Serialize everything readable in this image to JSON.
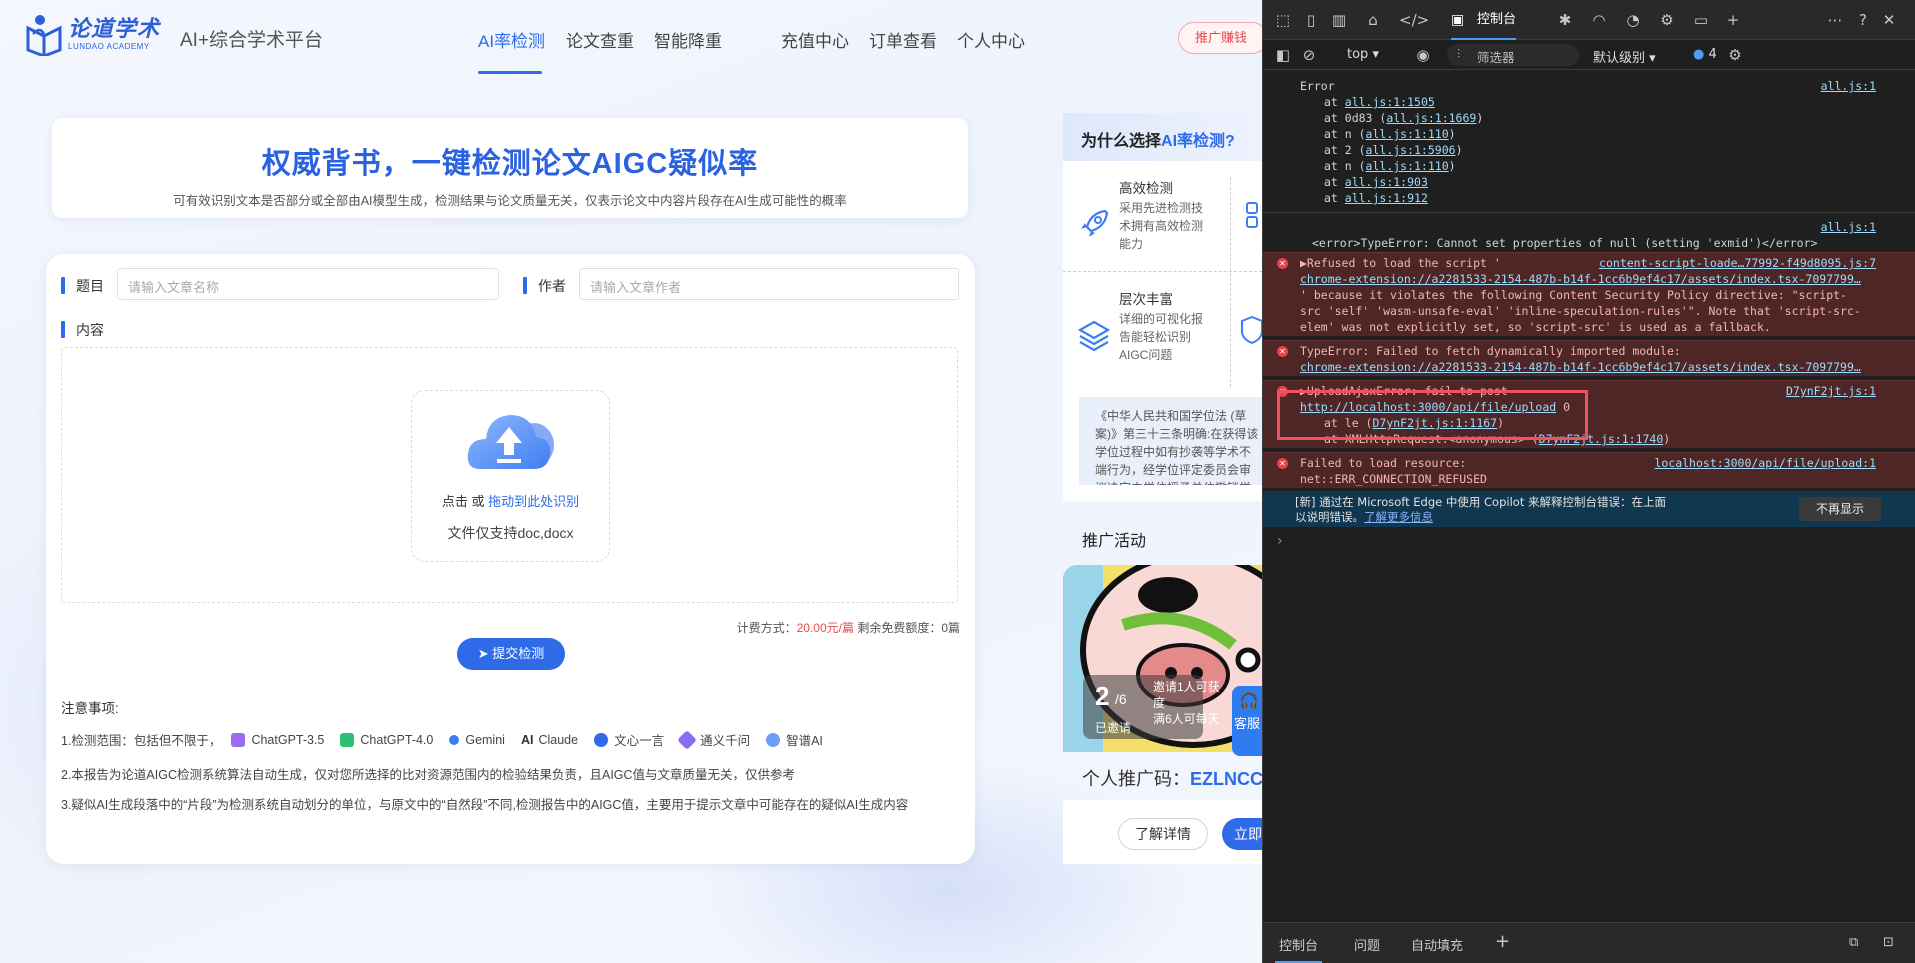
{
  "header": {
    "logo_cn": "论道学术",
    "logo_en": "LUNDAO ACADEMY",
    "platform": "AI+综合学术平台",
    "nav": [
      "AI率检测",
      "论文查重",
      "智能降重",
      "充值中心",
      "订单查看",
      "个人中心"
    ],
    "promo_button": "推广赚钱"
  },
  "hero": {
    "title": "权威背书，一键检测论文AIGC疑似率",
    "subtitle": "可有效识别文本是否部分或全部由AI模型生成，检测结果与论文质量无关，仅表示论文中内容片段存在AI生成可能性的概率"
  },
  "form": {
    "title_label": "题目",
    "title_placeholder": "请输入文章名称",
    "author_label": "作者",
    "author_placeholder": "请输入文章作者",
    "content_label": "内容",
    "upload_click": "点击 或",
    "upload_drag": "拖动到此处识别",
    "upload_formats": "文件仅支持doc,docx",
    "pricing_label": "计费方式：",
    "pricing_value": "20.00元/篇",
    "free_quota": "剩余免费额度：0篇",
    "submit": "提交检测"
  },
  "notes": {
    "title": "注意事项:",
    "scope_prefix": "1.检测范围：包括但不限于，",
    "models": [
      {
        "name": "ChatGPT-3.5",
        "color": "#9b6cf0"
      },
      {
        "name": "ChatGPT-4.0",
        "color": "#2fbf71"
      },
      {
        "name": "Gemini",
        "color": "#3b7ff0"
      },
      {
        "name": "Claude",
        "color": "#333333"
      },
      {
        "name": "文心一言",
        "color": "#2f6be8"
      },
      {
        "name": "通义千问",
        "color": "#8a6cf0"
      },
      {
        "name": "智谱AI",
        "color": "#6aa0f5"
      }
    ],
    "line2": "2.本报告为论道AIGC检测系统算法自动生成，仅对您所选择的比对资源范围内的检验结果负责，且AIGC值与文章质量无关，仅供参考",
    "line3": "3.疑似AI生成段落中的“片段”为检测系统自动划分的单位，与原文中的“自然段”不同,检测报告中的AIGC值，主要用于提示文章中可能存在的疑似AI生成内容"
  },
  "side": {
    "why_prefix": "为什么选择",
    "why_highlight": "AI率检测?",
    "features": [
      {
        "title": "高效检测",
        "desc": "采用先进检测技术拥有高效检测能力",
        "icon": "rocket-icon"
      },
      {
        "title": "层次丰富",
        "desc": "详细的可视化报告能轻松识别AIGC问题",
        "icon": "layers-icon"
      }
    ],
    "law": "《中华人民共和国学位法 (草案)》第三十三条明确:在获得该学位过程中如有抄袭等学术不端行为，经学位评定委员会审议决定由学位授予单位撤销学位证书。",
    "promo_title": "推广活动",
    "invite_count": "2",
    "invite_total": "6",
    "invited_label": "已邀请",
    "invite_text1": "邀请1人可获",
    "invite_text2": "度",
    "invite_text3": "满6人可每天",
    "code_label": "个人推广码：",
    "code_value": "EZLNCC",
    "learn_more": "了解详情",
    "promote_now": "立即",
    "service": "客服"
  },
  "devtools": {
    "active_tab": "控制台",
    "context": "top",
    "filter_placeholder": "筛选器",
    "level": "默认级别",
    "issue_count": "4",
    "logs": {
      "error_head": "Error",
      "error_src": "all.js:1",
      "stack": [
        {
          "pre": "at ",
          "link": "all.js:1:1505",
          "post": ""
        },
        {
          "pre": "at 0d83 (",
          "link": "all.js:1:1669",
          "post": ")"
        },
        {
          "pre": "at n (",
          "link": "all.js:1:110",
          "post": ")"
        },
        {
          "pre": "at 2 (",
          "link": "all.js:1:5906",
          "post": ")"
        },
        {
          "pre": "at n (",
          "link": "all.js:1:110",
          "post": ")"
        },
        {
          "pre": "at ",
          "link": "all.js:1:903",
          "post": ""
        },
        {
          "pre": "at ",
          "link": "all.js:1:912",
          "post": ""
        }
      ],
      "type_error_src": "all.js:1",
      "type_error": "<error>TypeError: Cannot set properties of null (setting 'exmid')</error>",
      "csp_prefix": "▶Refused to load the script '",
      "csp_src": "content-script-loade…77992-f49d8095.js:7",
      "csp_url": "chrome-extension://a2281533-2154-487b-b14f-1cc6b9ef4c17/assets/index.tsx-7097799…",
      "csp_rest1": "' because it violates the following Content Security Policy directive: \"script-",
      "csp_rest2": "src 'self' 'wasm-unsafe-eval' 'inline-speculation-rules'\". Note that 'script-src-",
      "csp_rest3": "elem' was not explicitly set, so 'script-src' is used as a fallback.",
      "fetch_err": "TypeError: Failed to fetch dynamically imported module:",
      "fetch_url": "chrome-extension://a2281533-2154-487b-b14f-1cc6b9ef4c17/assets/index.tsx-7097799…",
      "upload_err": "▶UploadAjaxError: fail to post",
      "upload_src": "D7ynF2jt.js:1",
      "upload_url": "http://localhost:3000/api/file/upload",
      "upload_code": " 0",
      "upload_at1_pre": "at le (",
      "upload_at1_link": "D7ynF2jt.js:1:1167",
      "upload_at2_pre": "at XMLHttpRequest.<anonymous> (",
      "upload_at2_link": "D7ynF2jt.js:1:1740",
      "res_err1": "Failed to load resource:",
      "res_err2": "net::ERR_CONNECTION_REFUSED",
      "res_src": "localhost:3000/api/file/upload:1"
    },
    "copilot1": "[新] 通过在 Microsoft Edge 中使用 Copilot 来解释控制台错误：在上面",
    "copilot2": "以说明错误。",
    "copilot_link": "了解更多信息",
    "dont_show": "不再显示",
    "bottom_tabs": [
      "控制台",
      "问题",
      "自动填充"
    ]
  }
}
